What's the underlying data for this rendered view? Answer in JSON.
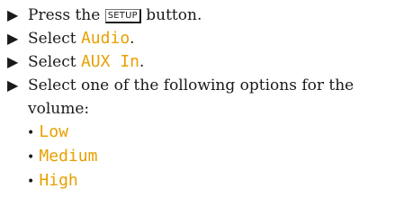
{
  "instructions": {
    "step1": {
      "prefix": "Press the ",
      "key": "SETUP",
      "suffix": " button."
    },
    "step2": {
      "prefix": "Select ",
      "item": "Audio",
      "suffix": "."
    },
    "step3": {
      "prefix": "Select ",
      "item": "AUX In",
      "suffix": "."
    },
    "step4": {
      "text": "Select one of the following options for the volume:"
    },
    "options": [
      {
        "label": "Low"
      },
      {
        "label": "Medium"
      },
      {
        "label": "High"
      }
    ]
  },
  "colors": {
    "menu_text": "#e8a000",
    "body_text": "#1a1a1a"
  },
  "icons": {
    "step_marker": "arrow-right-triangle-icon",
    "option_marker": "bullet-dot-icon"
  }
}
